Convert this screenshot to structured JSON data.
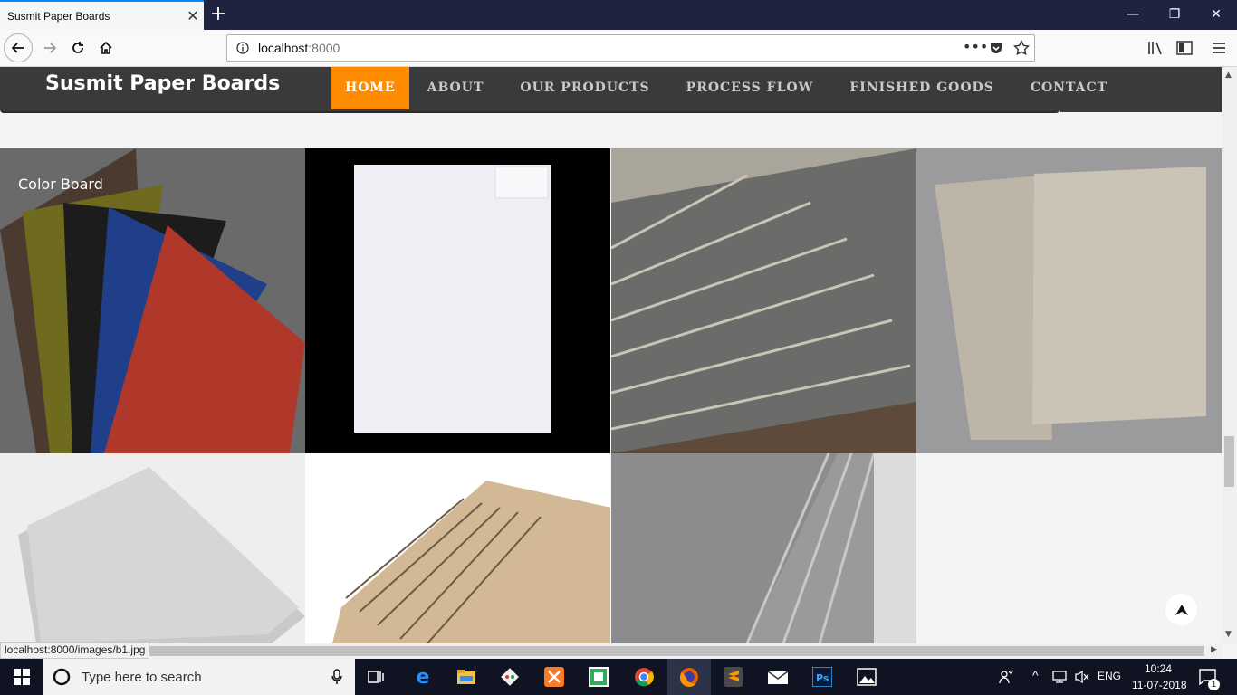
{
  "browser": {
    "tab_title": "Susmit Paper Boards",
    "url_host": "localhost",
    "url_port": ":8000",
    "status_url": "localhost:8000/images/b1.jpg"
  },
  "site": {
    "brand": "Susmit Paper Boards",
    "menu": [
      "HOME",
      "ABOUT",
      "OUR PRODUCTS",
      "PROCESS FLOW",
      "FINISHED GOODS",
      "CONTACT"
    ],
    "active_menu": "HOME",
    "gallery_caption": "Color Board"
  },
  "taskbar": {
    "search_placeholder": "Type here to search",
    "language": "ENG",
    "time": "10:24",
    "date": "11-07-2018",
    "notification_count": "1"
  },
  "colors": {
    "accent": "#ff8c00",
    "header_bg": "#3a3a3a",
    "tabbar_bg": "#202340"
  }
}
